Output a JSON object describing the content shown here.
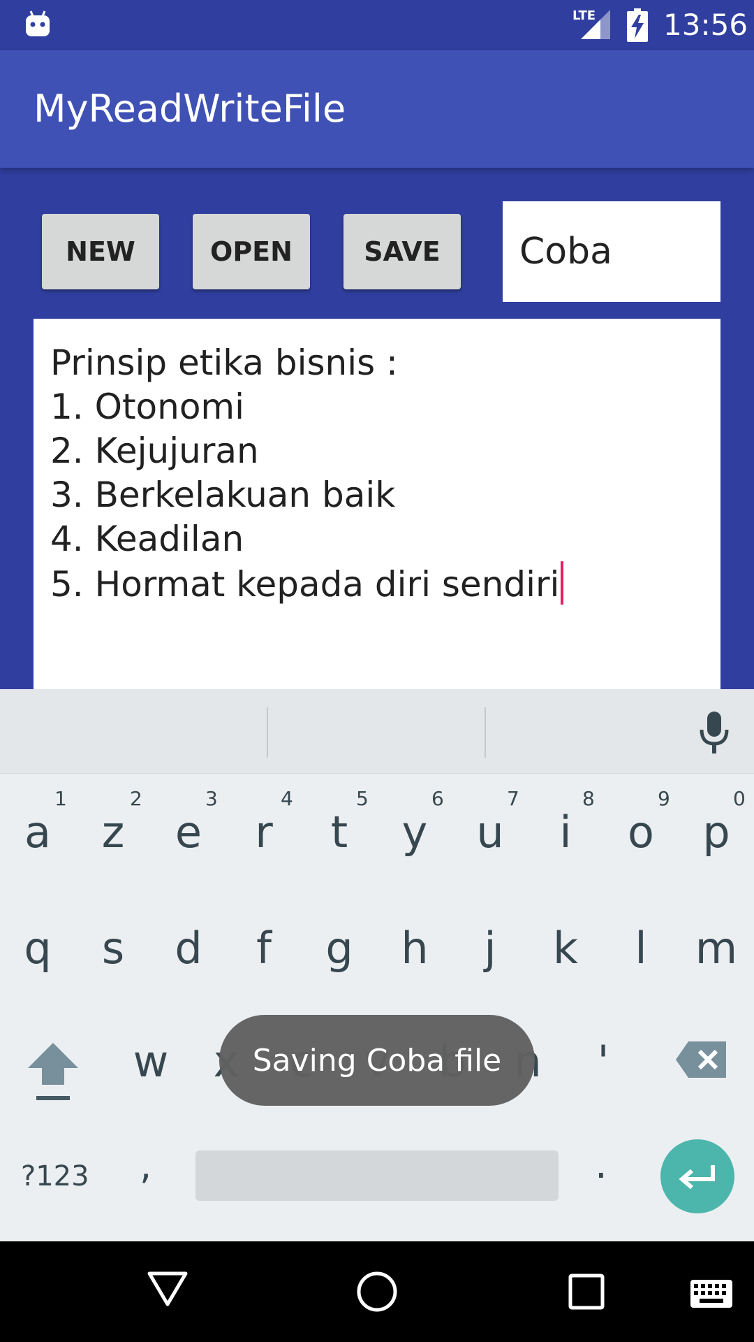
{
  "status_bar": {
    "time": "13:56",
    "network_label": "LTE",
    "icons": [
      "android-debug-icon",
      "lte-signal-icon",
      "battery-charging-icon"
    ]
  },
  "app_bar": {
    "title": "MyReadWriteFile"
  },
  "toolbar": {
    "new_label": "NEW",
    "open_label": "OPEN",
    "save_label": "SAVE",
    "filename_value": "Coba"
  },
  "editor": {
    "lines": [
      "Prinsip etika bisnis :",
      "1. Otonomi",
      "2. Kejujuran",
      "3. Berkelakuan baik",
      "4. Keadilan",
      "5. Hormat kepada diri sendiri"
    ]
  },
  "keyboard": {
    "row1": [
      "a",
      "z",
      "e",
      "r",
      "t",
      "y",
      "u",
      "i",
      "o",
      "p"
    ],
    "row1_hints": [
      "1",
      "2",
      "3",
      "4",
      "5",
      "6",
      "7",
      "8",
      "9",
      "0"
    ],
    "row2": [
      "q",
      "s",
      "d",
      "f",
      "g",
      "h",
      "j",
      "k",
      "l",
      "m"
    ],
    "row3": [
      "w",
      "x",
      "c",
      "v",
      "b",
      "n",
      "'"
    ],
    "symbols_label": "?123",
    "comma": ",",
    "period": "."
  },
  "toast": {
    "message": "Saving Coba file"
  },
  "colors": {
    "primary_dark": "#303F9F",
    "primary": "#3F51B5",
    "accent": "#E91E63",
    "enter_key": "#4DB6AC"
  }
}
